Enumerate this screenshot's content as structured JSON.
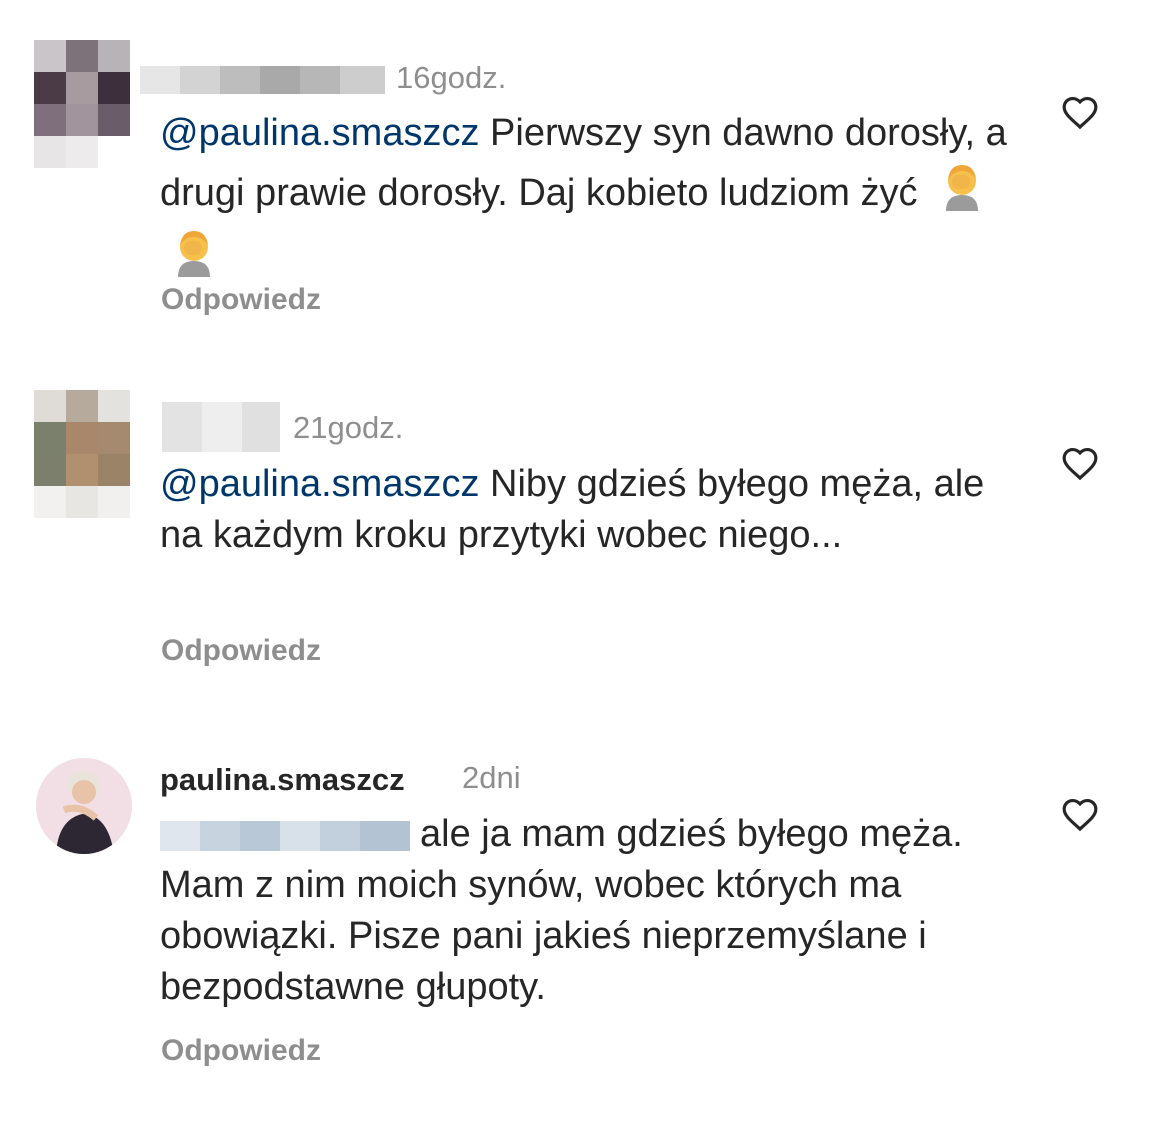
{
  "comments": [
    {
      "time": "16godz.",
      "mention": "@paulina.smaszcz",
      "text": " Pierwszy syn dawno dorosły, a drugi prawie dorosły.  Daj kobieto ludziom żyć ",
      "emoji": "face-palm-emoji",
      "reply_label": "Odpowiedz"
    },
    {
      "time": "21godz.",
      "mention": "@paulina.smaszcz",
      "text": " Niby gdzieś byłego męża, ale na każdym kroku przytyki wobec niego...",
      "reply_label": "Odpowiedz"
    },
    {
      "username": "paulina.smaszcz",
      "time": "2dni",
      "text": "ale ja mam gdzieś byłego męża. Mam z nim moich synów, wobec których ma obowiązki. Pisze pani jakieś nieprzemyślane i bezpodstawne głupoty.",
      "reply_label": "Odpowiedz"
    }
  ],
  "icons": {
    "like": "heart-outline-icon"
  },
  "colors": {
    "mention": "#00376b",
    "secondary": "#8e8e8e",
    "text": "#262626"
  }
}
